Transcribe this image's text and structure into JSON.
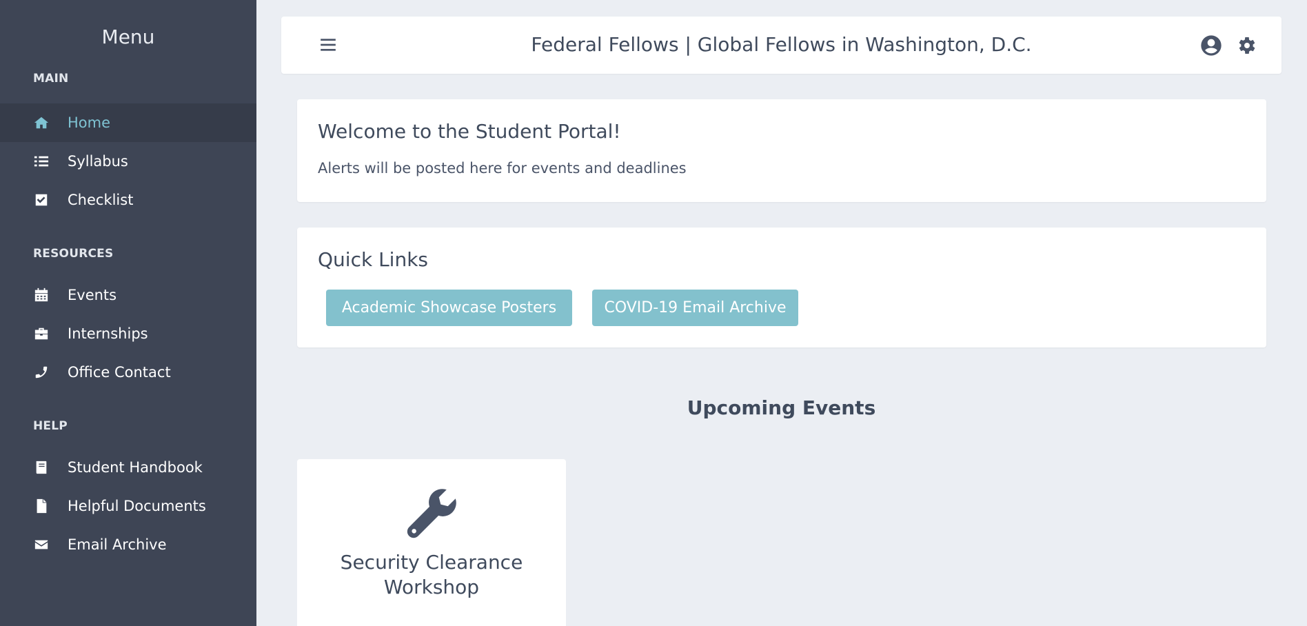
{
  "sidebar": {
    "title": "Menu",
    "sections": [
      {
        "label": "MAIN",
        "items": [
          {
            "label": "Home",
            "icon": "home-icon",
            "active": true
          },
          {
            "label": "Syllabus",
            "icon": "list-icon"
          },
          {
            "label": "Checklist",
            "icon": "checkbox-icon"
          }
        ]
      },
      {
        "label": "RESOURCES",
        "items": [
          {
            "label": "Events",
            "icon": "calendar-icon"
          },
          {
            "label": "Internships",
            "icon": "briefcase-icon"
          },
          {
            "label": "Office Contact",
            "icon": "phone-icon"
          }
        ]
      },
      {
        "label": "HELP",
        "items": [
          {
            "label": "Student Handbook",
            "icon": "book-icon"
          },
          {
            "label": "Helpful Documents",
            "icon": "document-icon"
          },
          {
            "label": "Email Archive",
            "icon": "envelope-icon"
          }
        ]
      }
    ]
  },
  "header": {
    "title": "Federal Fellows | Global Fellows in Washington, D.C."
  },
  "welcome": {
    "title": "Welcome to the Student Portal!",
    "text": "Alerts will be posted here for events and deadlines"
  },
  "quick_links": {
    "title": "Quick Links",
    "buttons": [
      "Academic Showcase Posters",
      "COVID-19 Email Archive"
    ]
  },
  "events": {
    "heading": "Upcoming Events",
    "items": [
      {
        "title": "Security Clearance Workshop",
        "icon": "wrench-icon"
      }
    ]
  },
  "colors": {
    "sidebar_bg": "#3e4555",
    "accent": "#7fc3d3",
    "button_bg": "#83c1cd",
    "page_bg": "#ebeef3"
  }
}
